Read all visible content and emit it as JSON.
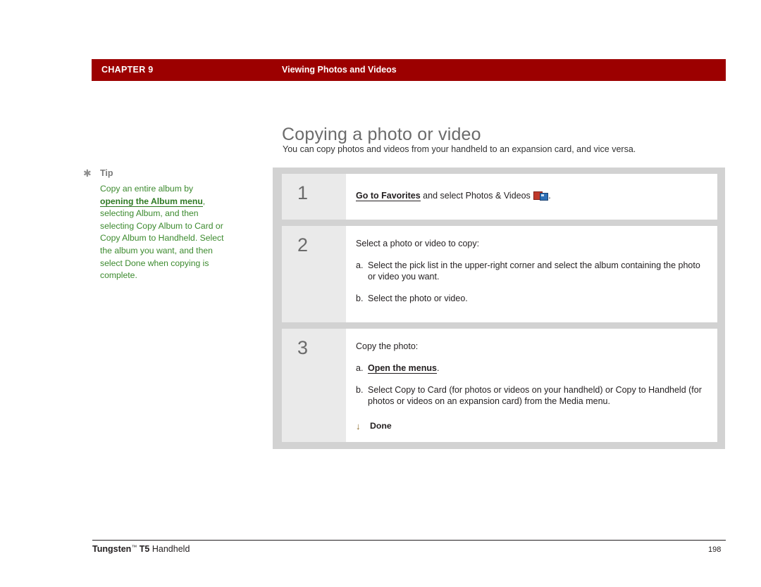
{
  "header": {
    "chapter": "CHAPTER 9",
    "section": "Viewing Photos and Videos",
    "bar_color": "#9c0000"
  },
  "title": "Copying a photo or video",
  "intro": "You can copy photos and videos from your handheld to an expansion card, and vice versa.",
  "tip": {
    "icon": "asterisk-icon",
    "label": "Tip",
    "text_before": "Copy an entire album by ",
    "link_text": "opening the Album menu",
    "text_after": ", selecting Album, and then selecting Copy Album to Card or Copy Album to Handheld. Select the album you want, and then select Done when copying is complete.",
    "color": "#3c8a2e"
  },
  "steps": [
    {
      "number": "1",
      "lead_link": "Go to Favorites",
      "lead_rest": " and select Photos & Videos",
      "lead_tail": ".",
      "icon": "photos-videos-icon",
      "subs": []
    },
    {
      "number": "2",
      "lead": "Select a photo or video to copy:",
      "subs": [
        {
          "letter": "a.",
          "text": "Select the pick list in the upper-right corner and select the album containing the photo or video you want."
        },
        {
          "letter": "b.",
          "text": "Select the photo or video."
        }
      ]
    },
    {
      "number": "3",
      "lead": "Copy the photo:",
      "subs": [
        {
          "letter": "a.",
          "bold_link": "Open the menus",
          "text_after": "."
        },
        {
          "letter": "b.",
          "text": "Select Copy to Card (for photos or videos on your handheld) or Copy to Handheld (for photos or videos on an expansion card) from the Media menu."
        }
      ],
      "done": {
        "icon": "down-arrow-icon",
        "label": "Done"
      }
    }
  ],
  "footer": {
    "product_bold": "Tungsten",
    "product_tm": "™",
    "product_rest": " T5 ",
    "product_tail": "Handheld",
    "page_number": "198"
  }
}
